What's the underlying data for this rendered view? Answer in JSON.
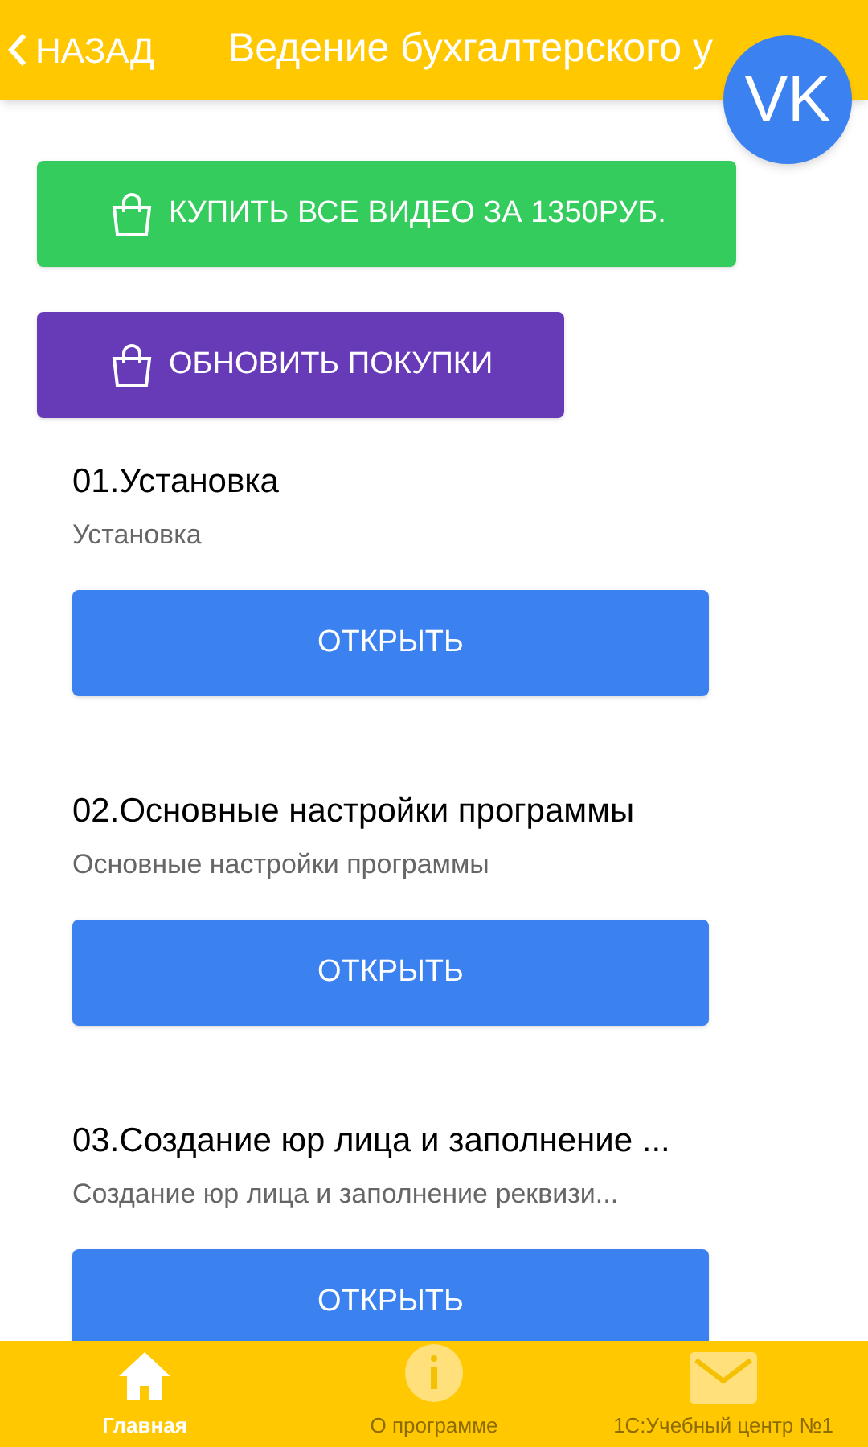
{
  "header": {
    "back_label": "НАЗАД",
    "title": "Ведение бухгалтерского у",
    "avatar": "VK"
  },
  "actions": [
    {
      "label": "КУПИТЬ ВСЕ ВИДЕО ЗА 1350РУБ.",
      "color": "#34cc5d"
    },
    {
      "label": "ОБНОВИТЬ ПОКУПКИ",
      "color": "#673ab7"
    }
  ],
  "lessons": [
    {
      "title": "01.Установка",
      "subtitle": "Установка",
      "button": "ОТКРЫТЬ"
    },
    {
      "title": "02.Основные настройки программы",
      "subtitle": "Основные настройки программы",
      "button": "ОТКРЫТЬ"
    },
    {
      "title": "03.Создание юр лица и заполнение ...",
      "subtitle": "Создание юр лица и заполнение реквизи...",
      "button": "ОТКРЫТЬ"
    }
  ],
  "tabs": [
    {
      "label": "Главная",
      "kind": "home",
      "selected": true
    },
    {
      "label": "О программе",
      "kind": "info",
      "selected": false
    },
    {
      "label": "1С:Учебный центр №1",
      "kind": "mail",
      "selected": false
    }
  ]
}
